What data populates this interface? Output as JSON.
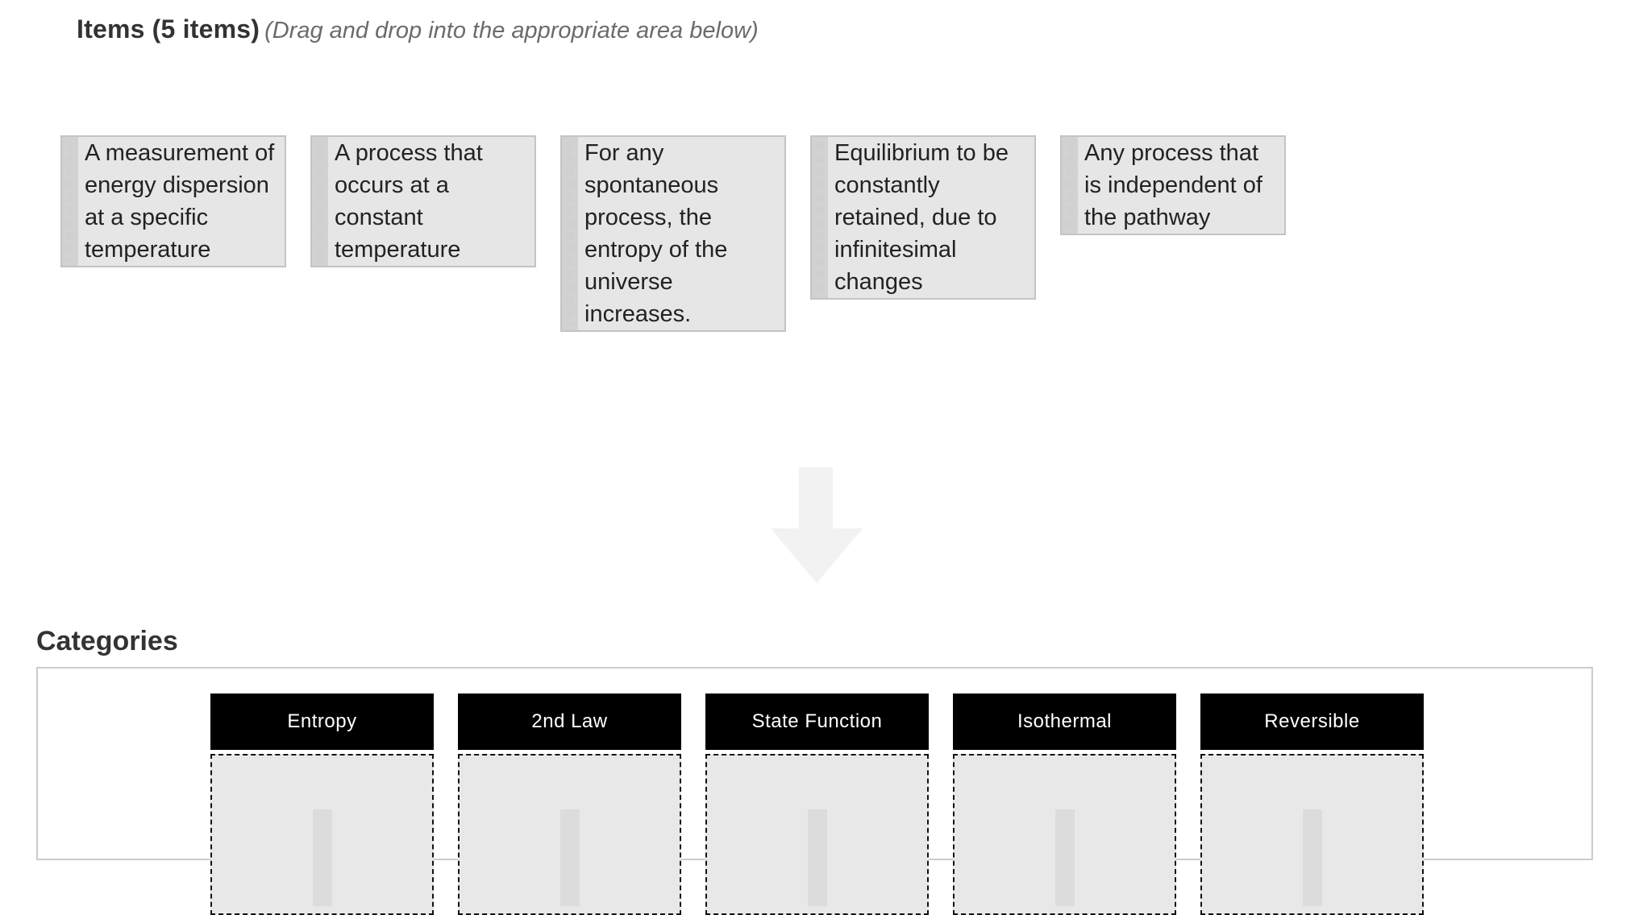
{
  "items_section": {
    "title": "Items (5 items)",
    "hint": "(Drag and drop into the appropriate area below)",
    "items": [
      {
        "text": "A measurement of energy dispersion at a specific temperature",
        "icon": "drag-handle-icon"
      },
      {
        "text": "A process that occurs at a constant temperature",
        "icon": "drag-handle-icon"
      },
      {
        "text": "For any spontaneous process, the entropy of the universe increases.",
        "icon": "drag-handle-icon"
      },
      {
        "text": "Equilibrium to be constantly retained, due to infinitesimal changes",
        "icon": "drag-handle-icon"
      },
      {
        "text": "Any process that is independent of the pathway",
        "icon": "drag-handle-icon"
      }
    ]
  },
  "divider_icon": "arrow-down-icon",
  "categories_section": {
    "title": "Categories",
    "categories": [
      {
        "label": "Entropy"
      },
      {
        "label": "2nd Law"
      },
      {
        "label": "State Function"
      },
      {
        "label": "Isothermal"
      },
      {
        "label": "Reversible"
      }
    ]
  },
  "colors": {
    "card_background": "#e6e6e6",
    "card_border": "#c4c4c4",
    "category_header": "#000000",
    "drop_zone": "#e8e8e8",
    "hint_text": "#6b6b6b"
  }
}
